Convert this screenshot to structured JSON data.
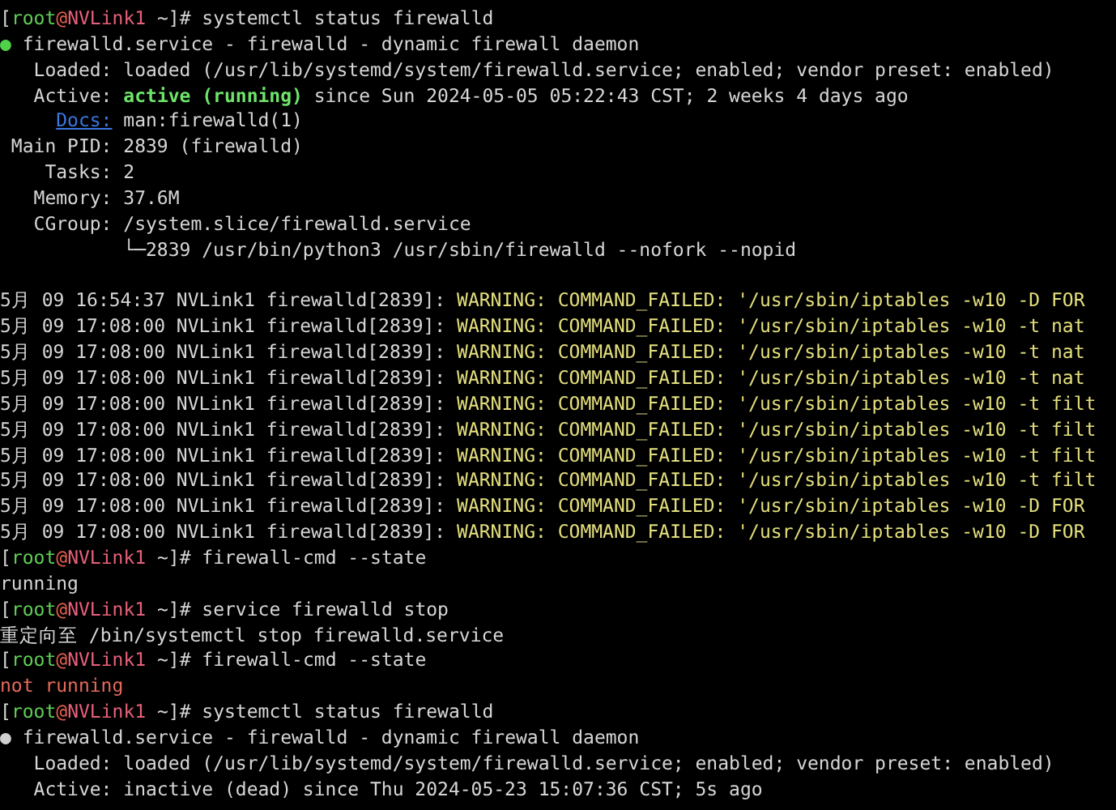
{
  "terminal": {
    "lines": [
      {
        "kind": "prompt",
        "segments": [
          {
            "kind": "text",
            "text": "["
          },
          {
            "kind": "user",
            "text": "root"
          },
          {
            "kind": "at",
            "text": "@"
          },
          {
            "kind": "host",
            "text": "NVLink1"
          },
          {
            "kind": "text",
            "text": " ~]# systemctl status firewalld"
          }
        ]
      },
      {
        "kind": "output",
        "segments": [
          {
            "kind": "dot_on",
            "text": "●"
          },
          {
            "kind": "text",
            "text": " firewalld.service - firewalld - dynamic firewall daemon"
          }
        ]
      },
      {
        "kind": "output",
        "segments": [
          {
            "kind": "text",
            "text": "   Loaded: loaded (/usr/lib/systemd/system/firewalld.service; enabled; vendor preset: enabled)"
          }
        ]
      },
      {
        "kind": "output",
        "segments": [
          {
            "kind": "text",
            "text": "   Active: "
          },
          {
            "kind": "active",
            "text": "active (running)"
          },
          {
            "kind": "text",
            "text": " since Sun 2024-05-05 05:22:43 CST; 2 weeks 4 days ago"
          }
        ]
      },
      {
        "kind": "indented",
        "segments": [
          {
            "kind": "link",
            "text": "Docs:"
          },
          {
            "kind": "text",
            "text": " man:firewalld(1)"
          }
        ]
      },
      {
        "kind": "output",
        "segments": [
          {
            "kind": "text",
            "text": " Main PID: 2839 (firewalld)"
          }
        ]
      },
      {
        "kind": "output",
        "segments": [
          {
            "kind": "text",
            "text": "    Tasks: 2"
          }
        ]
      },
      {
        "kind": "output",
        "segments": [
          {
            "kind": "text",
            "text": "   Memory: 37.6M"
          }
        ]
      },
      {
        "kind": "output",
        "segments": [
          {
            "kind": "text",
            "text": "   CGroup: /system.slice/firewalld.service"
          }
        ]
      },
      {
        "kind": "output",
        "segments": [
          {
            "kind": "text",
            "text": "           └─2839 /usr/bin/python3 /usr/sbin/firewalld --nofork --nopid"
          }
        ]
      },
      {
        "kind": "blank"
      },
      {
        "kind": "log",
        "segments": [
          {
            "kind": "text",
            "text": "5月 09 16:54:37 NVLink1 firewalld[2839]: "
          },
          {
            "kind": "warn",
            "text": "WARNING: COMMAND_FAILED: '/usr/sbin/iptables -w10 -D FOR"
          }
        ]
      },
      {
        "kind": "log",
        "segments": [
          {
            "kind": "text",
            "text": "5月 09 17:08:00 NVLink1 firewalld[2839]: "
          },
          {
            "kind": "warn",
            "text": "WARNING: COMMAND_FAILED: '/usr/sbin/iptables -w10 -t nat"
          }
        ]
      },
      {
        "kind": "log",
        "segments": [
          {
            "kind": "text",
            "text": "5月 09 17:08:00 NVLink1 firewalld[2839]: "
          },
          {
            "kind": "warn",
            "text": "WARNING: COMMAND_FAILED: '/usr/sbin/iptables -w10 -t nat"
          }
        ]
      },
      {
        "kind": "log",
        "segments": [
          {
            "kind": "text",
            "text": "5月 09 17:08:00 NVLink1 firewalld[2839]: "
          },
          {
            "kind": "warn",
            "text": "WARNING: COMMAND_FAILED: '/usr/sbin/iptables -w10 -t nat"
          }
        ]
      },
      {
        "kind": "log",
        "segments": [
          {
            "kind": "text",
            "text": "5月 09 17:08:00 NVLink1 firewalld[2839]: "
          },
          {
            "kind": "warn",
            "text": "WARNING: COMMAND_FAILED: '/usr/sbin/iptables -w10 -t filt"
          }
        ]
      },
      {
        "kind": "log",
        "segments": [
          {
            "kind": "text",
            "text": "5月 09 17:08:00 NVLink1 firewalld[2839]: "
          },
          {
            "kind": "warn",
            "text": "WARNING: COMMAND_FAILED: '/usr/sbin/iptables -w10 -t filt"
          }
        ]
      },
      {
        "kind": "log",
        "segments": [
          {
            "kind": "text",
            "text": "5月 09 17:08:00 NVLink1 firewalld[2839]: "
          },
          {
            "kind": "warn",
            "text": "WARNING: COMMAND_FAILED: '/usr/sbin/iptables -w10 -t filt"
          }
        ]
      },
      {
        "kind": "log",
        "segments": [
          {
            "kind": "text",
            "text": "5月 09 17:08:00 NVLink1 firewalld[2839]: "
          },
          {
            "kind": "warn",
            "text": "WARNING: COMMAND_FAILED: '/usr/sbin/iptables -w10 -t filt"
          }
        ]
      },
      {
        "kind": "log",
        "segments": [
          {
            "kind": "text",
            "text": "5月 09 17:08:00 NVLink1 firewalld[2839]: "
          },
          {
            "kind": "warn",
            "text": "WARNING: COMMAND_FAILED: '/usr/sbin/iptables -w10 -D FOR"
          }
        ]
      },
      {
        "kind": "log",
        "segments": [
          {
            "kind": "text",
            "text": "5月 09 17:08:00 NVLink1 firewalld[2839]: "
          },
          {
            "kind": "warn",
            "text": "WARNING: COMMAND_FAILED: '/usr/sbin/iptables -w10 -D FOR"
          }
        ]
      },
      {
        "kind": "prompt",
        "segments": [
          {
            "kind": "text",
            "text": "["
          },
          {
            "kind": "user",
            "text": "root"
          },
          {
            "kind": "at",
            "text": "@"
          },
          {
            "kind": "host",
            "text": "NVLink1"
          },
          {
            "kind": "text",
            "text": " ~]# firewall-cmd --state"
          }
        ]
      },
      {
        "kind": "output",
        "segments": [
          {
            "kind": "text",
            "text": "running"
          }
        ]
      },
      {
        "kind": "prompt",
        "segments": [
          {
            "kind": "text",
            "text": "["
          },
          {
            "kind": "user",
            "text": "root"
          },
          {
            "kind": "at",
            "text": "@"
          },
          {
            "kind": "host",
            "text": "NVLink1"
          },
          {
            "kind": "text",
            "text": " ~]# service firewalld stop"
          }
        ]
      },
      {
        "kind": "output",
        "segments": [
          {
            "kind": "text",
            "text": "重定向至 /bin/systemctl stop firewalld.service"
          }
        ]
      },
      {
        "kind": "prompt",
        "segments": [
          {
            "kind": "text",
            "text": "["
          },
          {
            "kind": "user",
            "text": "root"
          },
          {
            "kind": "at",
            "text": "@"
          },
          {
            "kind": "host",
            "text": "NVLink1"
          },
          {
            "kind": "text",
            "text": " ~]# firewall-cmd --state"
          }
        ]
      },
      {
        "kind": "output",
        "segments": [
          {
            "kind": "error",
            "text": "not running"
          }
        ]
      },
      {
        "kind": "prompt",
        "segments": [
          {
            "kind": "text",
            "text": "["
          },
          {
            "kind": "user",
            "text": "root"
          },
          {
            "kind": "at",
            "text": "@"
          },
          {
            "kind": "host",
            "text": "NVLink1"
          },
          {
            "kind": "text",
            "text": " ~]# systemctl status firewalld"
          }
        ]
      },
      {
        "kind": "output",
        "segments": [
          {
            "kind": "dot_off",
            "text": "●"
          },
          {
            "kind": "text",
            "text": " firewalld.service - firewalld - dynamic firewall daemon"
          }
        ]
      },
      {
        "kind": "output",
        "segments": [
          {
            "kind": "text",
            "text": "   Loaded: loaded (/usr/lib/systemd/system/firewalld.service; enabled; vendor preset: enabled)"
          }
        ]
      },
      {
        "kind": "output",
        "segments": [
          {
            "kind": "text",
            "text": "   Active: inactive (dead) since Thu 2024-05-23 15:07:36 CST; 5s ago"
          }
        ]
      }
    ]
  }
}
